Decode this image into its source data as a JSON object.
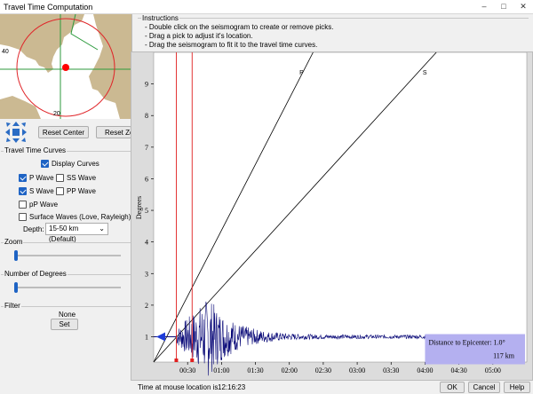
{
  "window": {
    "title": "Travel Time Computation",
    "minimize_glyph": "–",
    "maximize_glyph": "□",
    "close_glyph": "✕"
  },
  "map": {
    "label_lat_40": "40",
    "label_lat_20": "20",
    "circle_color": "#e0262a",
    "epicenter_color": "#ff0000",
    "land_color": "#cbb992",
    "sea_color": "#ffffff",
    "border_color": "#2c9a3c"
  },
  "map_controls": {
    "reset_center_label": "Reset Center",
    "reset_zoom_label": "Reset Zoom"
  },
  "travel_time_curves": {
    "group_label": "Travel Time Curves",
    "display_curves": {
      "label": "Display Curves",
      "checked": true
    },
    "p_wave": {
      "label": "P Wave",
      "checked": true
    },
    "ss_wave": {
      "label": "SS Wave",
      "checked": false
    },
    "s_wave": {
      "label": "S Wave",
      "checked": true
    },
    "pp_wave": {
      "label": "PP Wave",
      "checked": false
    },
    "pp_small_wave": {
      "label": "pP Wave",
      "checked": false
    },
    "surface_waves": {
      "label": "Surface Waves (Love, Rayleigh)",
      "checked": false
    },
    "depth_label": "Depth:",
    "depth_value": "15-50 km (Default)"
  },
  "zoom": {
    "group_label": "Zoom",
    "value": 0
  },
  "degrees": {
    "group_label": "Number of Degrees",
    "value": 0
  },
  "filter": {
    "group_label": "Filter",
    "current": "None",
    "set_label": "Set"
  },
  "instructions": {
    "group_label": "Instructions",
    "lines": [
      "- Double click on the seismogram to create or remove picks.",
      "- Drag a pick to adjust it's location.",
      "- Drag the seismogram to fit it to the travel time curves."
    ]
  },
  "chart_data": {
    "type": "line",
    "title": "",
    "xlabel": "",
    "ylabel": "Degrees",
    "x_ticks": [
      "00:30",
      "01:00",
      "01:30",
      "02:00",
      "02:30",
      "03:00",
      "03:30",
      "04:00",
      "04:30",
      "05:00"
    ],
    "x_tick_values": [
      30,
      60,
      90,
      120,
      150,
      180,
      210,
      240,
      270,
      300
    ],
    "y_ticks": [
      "1",
      "2",
      "3",
      "4",
      "5",
      "6",
      "7",
      "8",
      "9"
    ],
    "y_tick_values": [
      1,
      2,
      3,
      4,
      5,
      6,
      7,
      8,
      9
    ],
    "xlim": [
      0,
      330
    ],
    "ylim": [
      0.2,
      10.0
    ],
    "series": [
      {
        "name": "P",
        "x": [
          0,
          141
        ],
        "y": [
          0.2,
          10.0
        ],
        "color": "#000000"
      },
      {
        "name": "S",
        "x": [
          0,
          250
        ],
        "y": [
          0.2,
          10.0
        ],
        "color": "#000000"
      }
    ],
    "picks_sec": [
      20,
      34
    ],
    "pick_color": "#e02020",
    "seismogram": {
      "baseline_degrees": 1.0,
      "onset_sec": 20,
      "peak_sec": 48,
      "end_sec": 255,
      "color": "#0a0a78"
    },
    "distance_box": {
      "label": "Distance to Epicenter:",
      "degrees_text": "1.0°",
      "km_text": "117 km",
      "color": "#b4b0f0"
    },
    "grid": false
  },
  "status": {
    "time_label": "Time at mouse location is",
    "time_value": "12:16:23",
    "ok_label": "OK",
    "cancel_label": "Cancel",
    "help_label": "Help"
  }
}
